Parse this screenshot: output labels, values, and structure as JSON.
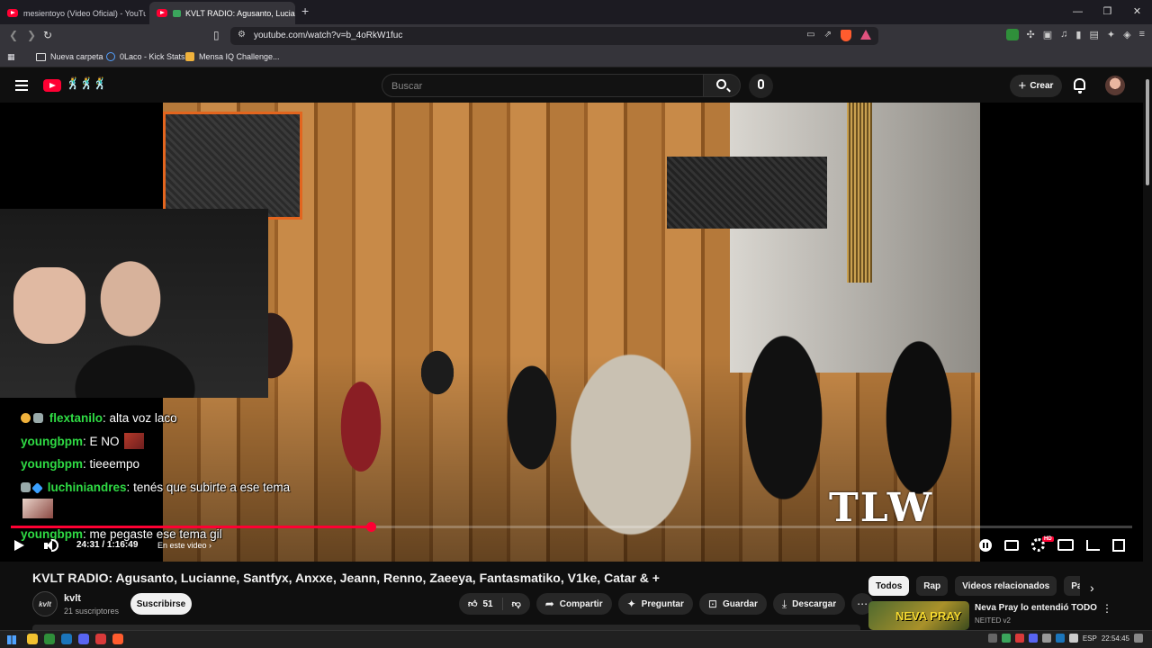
{
  "browser": {
    "tabs": [
      {
        "title": "mesientoyo (Video Oficial) - YouTube"
      },
      {
        "title": "KVLT RADIO: Agusanto, Luciar"
      }
    ],
    "new_tab": "+",
    "url": "youtube.com/watch?v=b_4oRkW1fuc",
    "bookmarks": [
      {
        "label": "Nueva carpeta"
      },
      {
        "label": "0Laco - Kick Stats"
      },
      {
        "label": "Mensa IQ Challenge..."
      }
    ]
  },
  "youtube": {
    "search_placeholder": "Buscar",
    "create_label": "Crear"
  },
  "player": {
    "progress_fraction": 0.321,
    "time": "24:31 / 1:16:49",
    "chapter_label": "En este video",
    "watermark": "TLW"
  },
  "chat": [
    {
      "user": "flextanilo",
      "msg": "alta voz laco"
    },
    {
      "user": "youngbpm",
      "msg": "E NO"
    },
    {
      "user": "youngbpm",
      "msg": "tieeempo"
    },
    {
      "user": "luchiniandres",
      "msg": "tenés que subirte a ese tema"
    },
    {
      "user": "youngbpm",
      "msg": "me pegaste ese tema gil"
    }
  ],
  "video": {
    "title": "KVLT RADIO: Agusanto, Lucianne, Santfyx, Anxxe, Jeann, Renno, Zaeeya, Fantasmatiko, V1ke, Catar & +",
    "channel": "kvlt",
    "channel_avatar_text": "kvlt",
    "subscribers": "21 suscriptores",
    "subscribe_label": "Suscribirse",
    "likes": "51",
    "share_label": "Compartir",
    "ask_label": "Preguntar",
    "save_label": "Guardar",
    "download_label": "Descargar"
  },
  "sidebar": {
    "chips": [
      "Todos",
      "Rap",
      "Videos relacionados",
      "Para ti"
    ],
    "recommendation": {
      "title": "Neva Pray lo entendió TODO",
      "channel": "NEITED v2",
      "thumb_text": "NEVA PRAY"
    }
  },
  "taskbar": {
    "lang": "ESP",
    "clock": "22:54:45"
  },
  "colors": {
    "accent": "#ff0033",
    "chat_user": "#2fdb44",
    "background": "#0f0f0f"
  }
}
